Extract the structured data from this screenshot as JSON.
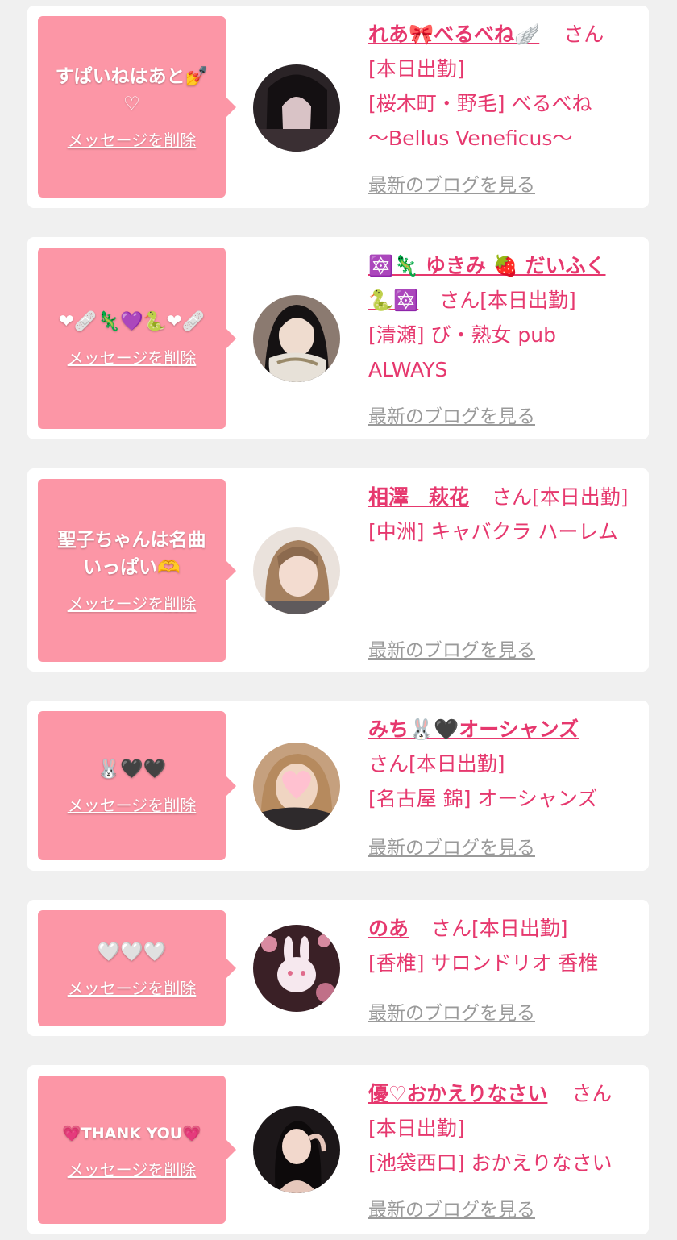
{
  "cards": [
    {
      "message": "すぱいねはあと💅\n♡",
      "delete_label": "メッセージを削除",
      "name": "れあ🎀べるべね🪽",
      "san": "さん",
      "line1": "[本日出勤]",
      "line2": "[桜木町・野毛] べるべね",
      "line3": "〜Bellus Veneficus〜",
      "blog_label": "最新のブログを見る"
    },
    {
      "message": "❤🩹🦎💜🐍❤🩹",
      "delete_label": "メッセージを削除",
      "name": "🔯🦎 ゆきみ 🍓 だいふく",
      "name_tail": "🐍🔯",
      "san": "さん",
      "line1": "[本日出勤]",
      "line2": "[清瀬] び・熟女 pub",
      "line3": "ALWAYS",
      "blog_label": "最新のブログを見る"
    },
    {
      "message": "聖子ちゃんは名曲\nいっぱい🫶",
      "delete_label": "メッセージを削除",
      "name": "相澤　萩花",
      "san": "さん",
      "line1": "[本日出勤]",
      "line2": "[中洲] キャバクラ ハーレム",
      "blog_label": "最新のブログを見る"
    },
    {
      "message": "🐰🖤🖤",
      "delete_label": "メッセージを削除",
      "name": "みち🐰🖤オーシャンズ",
      "san": "さん",
      "line1": "[本日出勤]",
      "line2": "[名古屋 錦] オーシャンズ",
      "blog_label": "最新のブログを見る"
    },
    {
      "message": "🤍🤍🤍",
      "delete_label": "メッセージを削除",
      "name": "のあ",
      "san": "さん",
      "line1": "[本日出勤]",
      "line2": "[香椎] サロンドリオ 香椎",
      "blog_label": "最新のブログを見る"
    },
    {
      "message": "💗THANK YOU💗",
      "delete_label": "メッセージを削除",
      "name": "優♡おかえりなさい",
      "san": "さん",
      "line1": "[本日出勤]",
      "line2": "[池袋西口] おかえりなさい",
      "blog_label": "最新のブログを見る"
    }
  ],
  "colors": {
    "accent": "#e6386e",
    "bubble": "#fc96a6",
    "page_bg": "#f0f0f0",
    "link_gray": "#9a9a9a"
  }
}
